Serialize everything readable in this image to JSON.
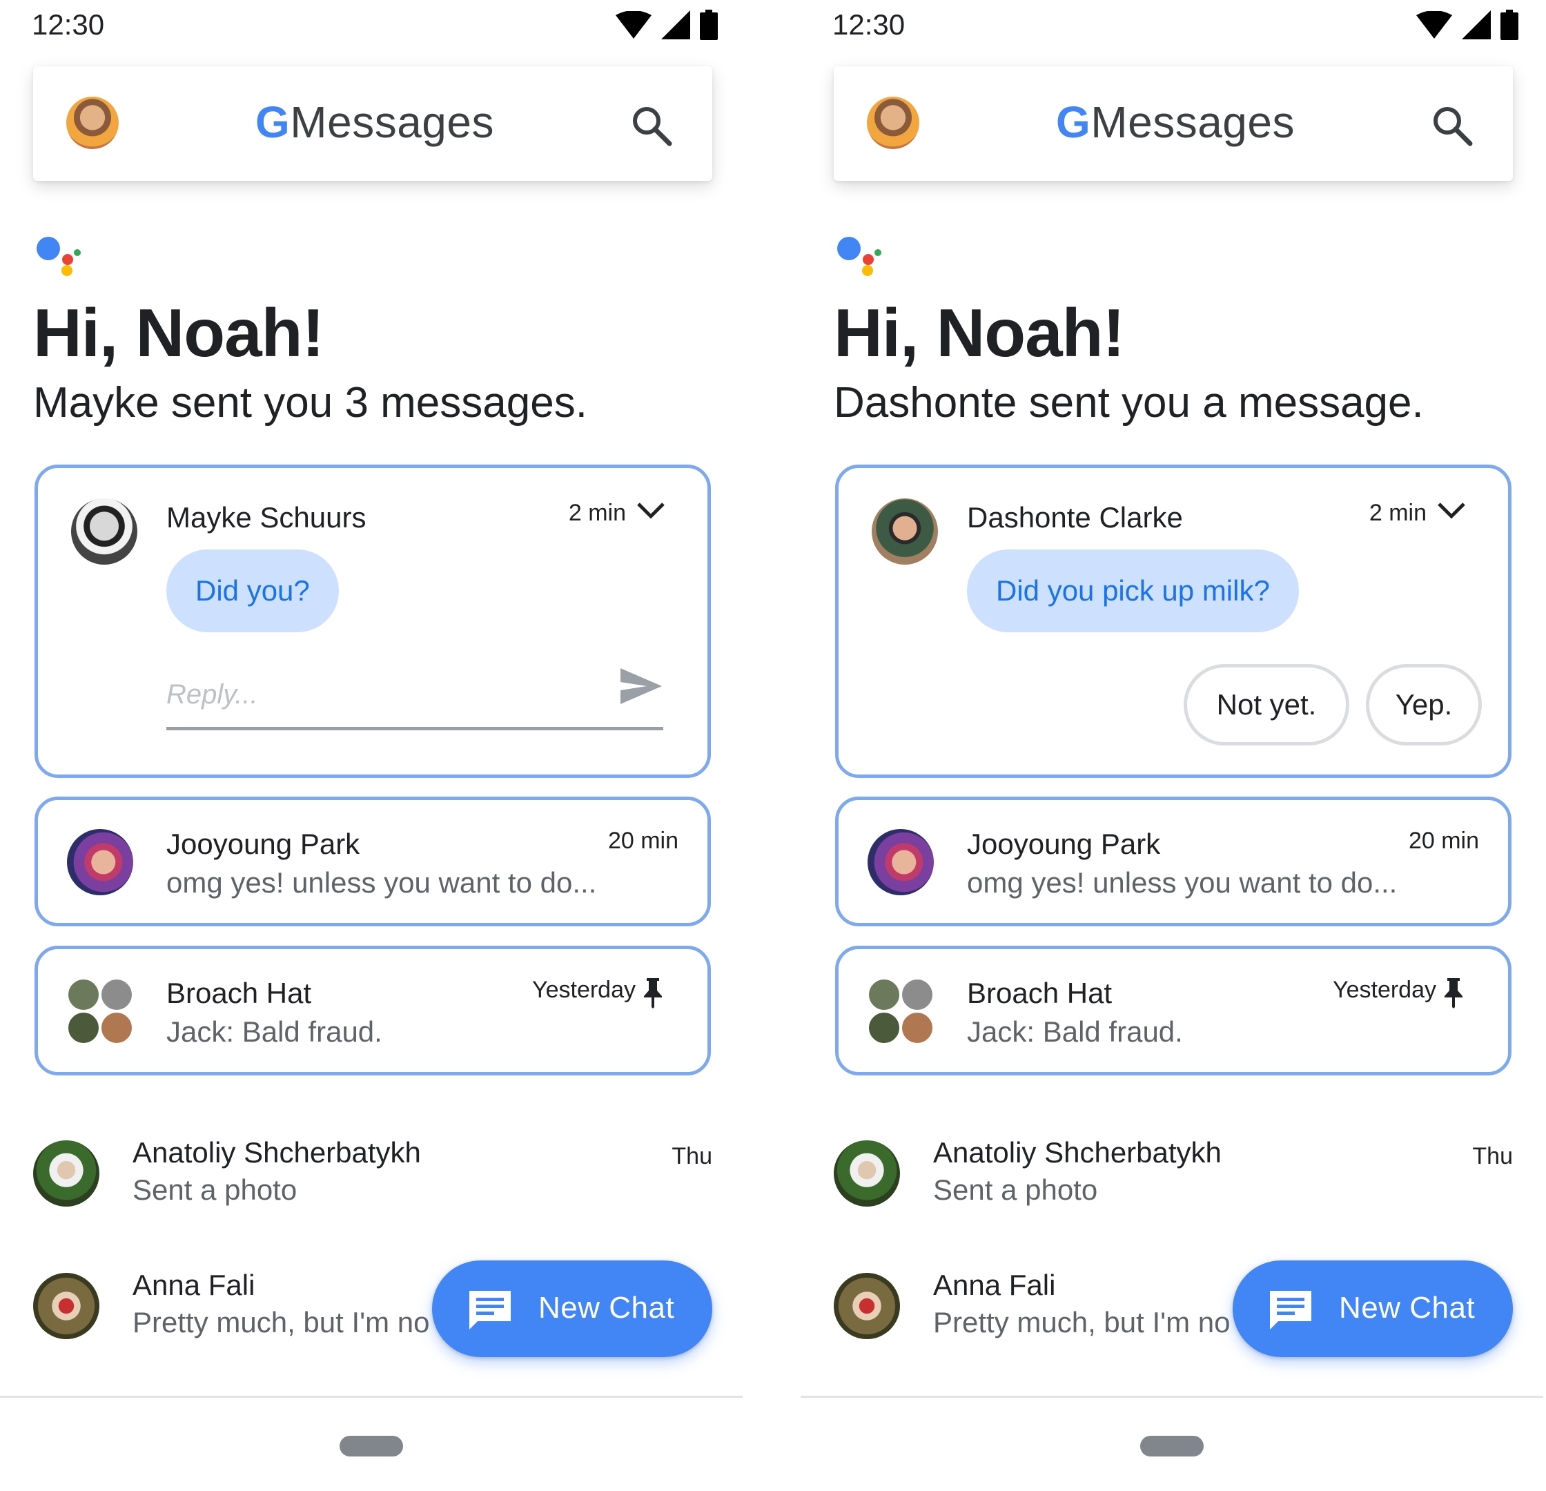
{
  "screens": [
    {
      "status": {
        "time": "12:30"
      },
      "header": {
        "logo_letter": "G",
        "title": "Messages",
        "search_icon": "search-icon"
      },
      "assistant": {
        "greeting": "Hi, Noah!",
        "summary": "Mayke sent you 3 messages."
      },
      "expanded_card": {
        "name": "Mayke Schuurs",
        "time": "2 min",
        "message": "Did you?",
        "reply_placeholder": "Reply..."
      },
      "cards": [
        {
          "name": "Jooyoung Park",
          "time": "20 min",
          "snippet": "omg yes! unless you want to do..."
        },
        {
          "name": "Broach Hat",
          "time": "Yesterday",
          "snippet": "Jack: Bald fraud.",
          "pinned": true
        }
      ],
      "list": [
        {
          "name": "Anatoliy Shcherbatykh",
          "time": "Thu",
          "snippet": "Sent a photo"
        },
        {
          "name": "Anna Fali",
          "time": "",
          "snippet": "Pretty much, but I'm no"
        }
      ],
      "fab": {
        "label": "New Chat"
      }
    },
    {
      "status": {
        "time": "12:30"
      },
      "header": {
        "logo_letter": "G",
        "title": "Messages",
        "search_icon": "search-icon"
      },
      "assistant": {
        "greeting": "Hi, Noah!",
        "summary": "Dashonte sent you a message."
      },
      "expanded_card": {
        "name": "Dashonte Clarke",
        "time": "2 min",
        "message": "Did you pick up milk?",
        "suggestions": [
          "Not yet.",
          "Yep."
        ]
      },
      "cards": [
        {
          "name": "Jooyoung Park",
          "time": "20 min",
          "snippet": "omg yes! unless you want to do..."
        },
        {
          "name": "Broach Hat",
          "time": "Yesterday",
          "snippet": "Jack: Bald fraud.",
          "pinned": true
        }
      ],
      "list": [
        {
          "name": "Anatoliy Shcherbatykh",
          "time": "Thu",
          "snippet": "Sent a photo"
        },
        {
          "name": "Anna Fali",
          "time": "",
          "snippet": "Pretty much, but I'm no"
        }
      ],
      "fab": {
        "label": "New Chat"
      }
    }
  ],
  "colors": {
    "accent": "#4285f4",
    "card_border": "#7fa9ee",
    "bubble_bg": "#cde0fd",
    "bubble_text": "#1a73e8",
    "assistant_dots": [
      "#4285f4",
      "#ea4335",
      "#fbbc04",
      "#34a853"
    ]
  }
}
